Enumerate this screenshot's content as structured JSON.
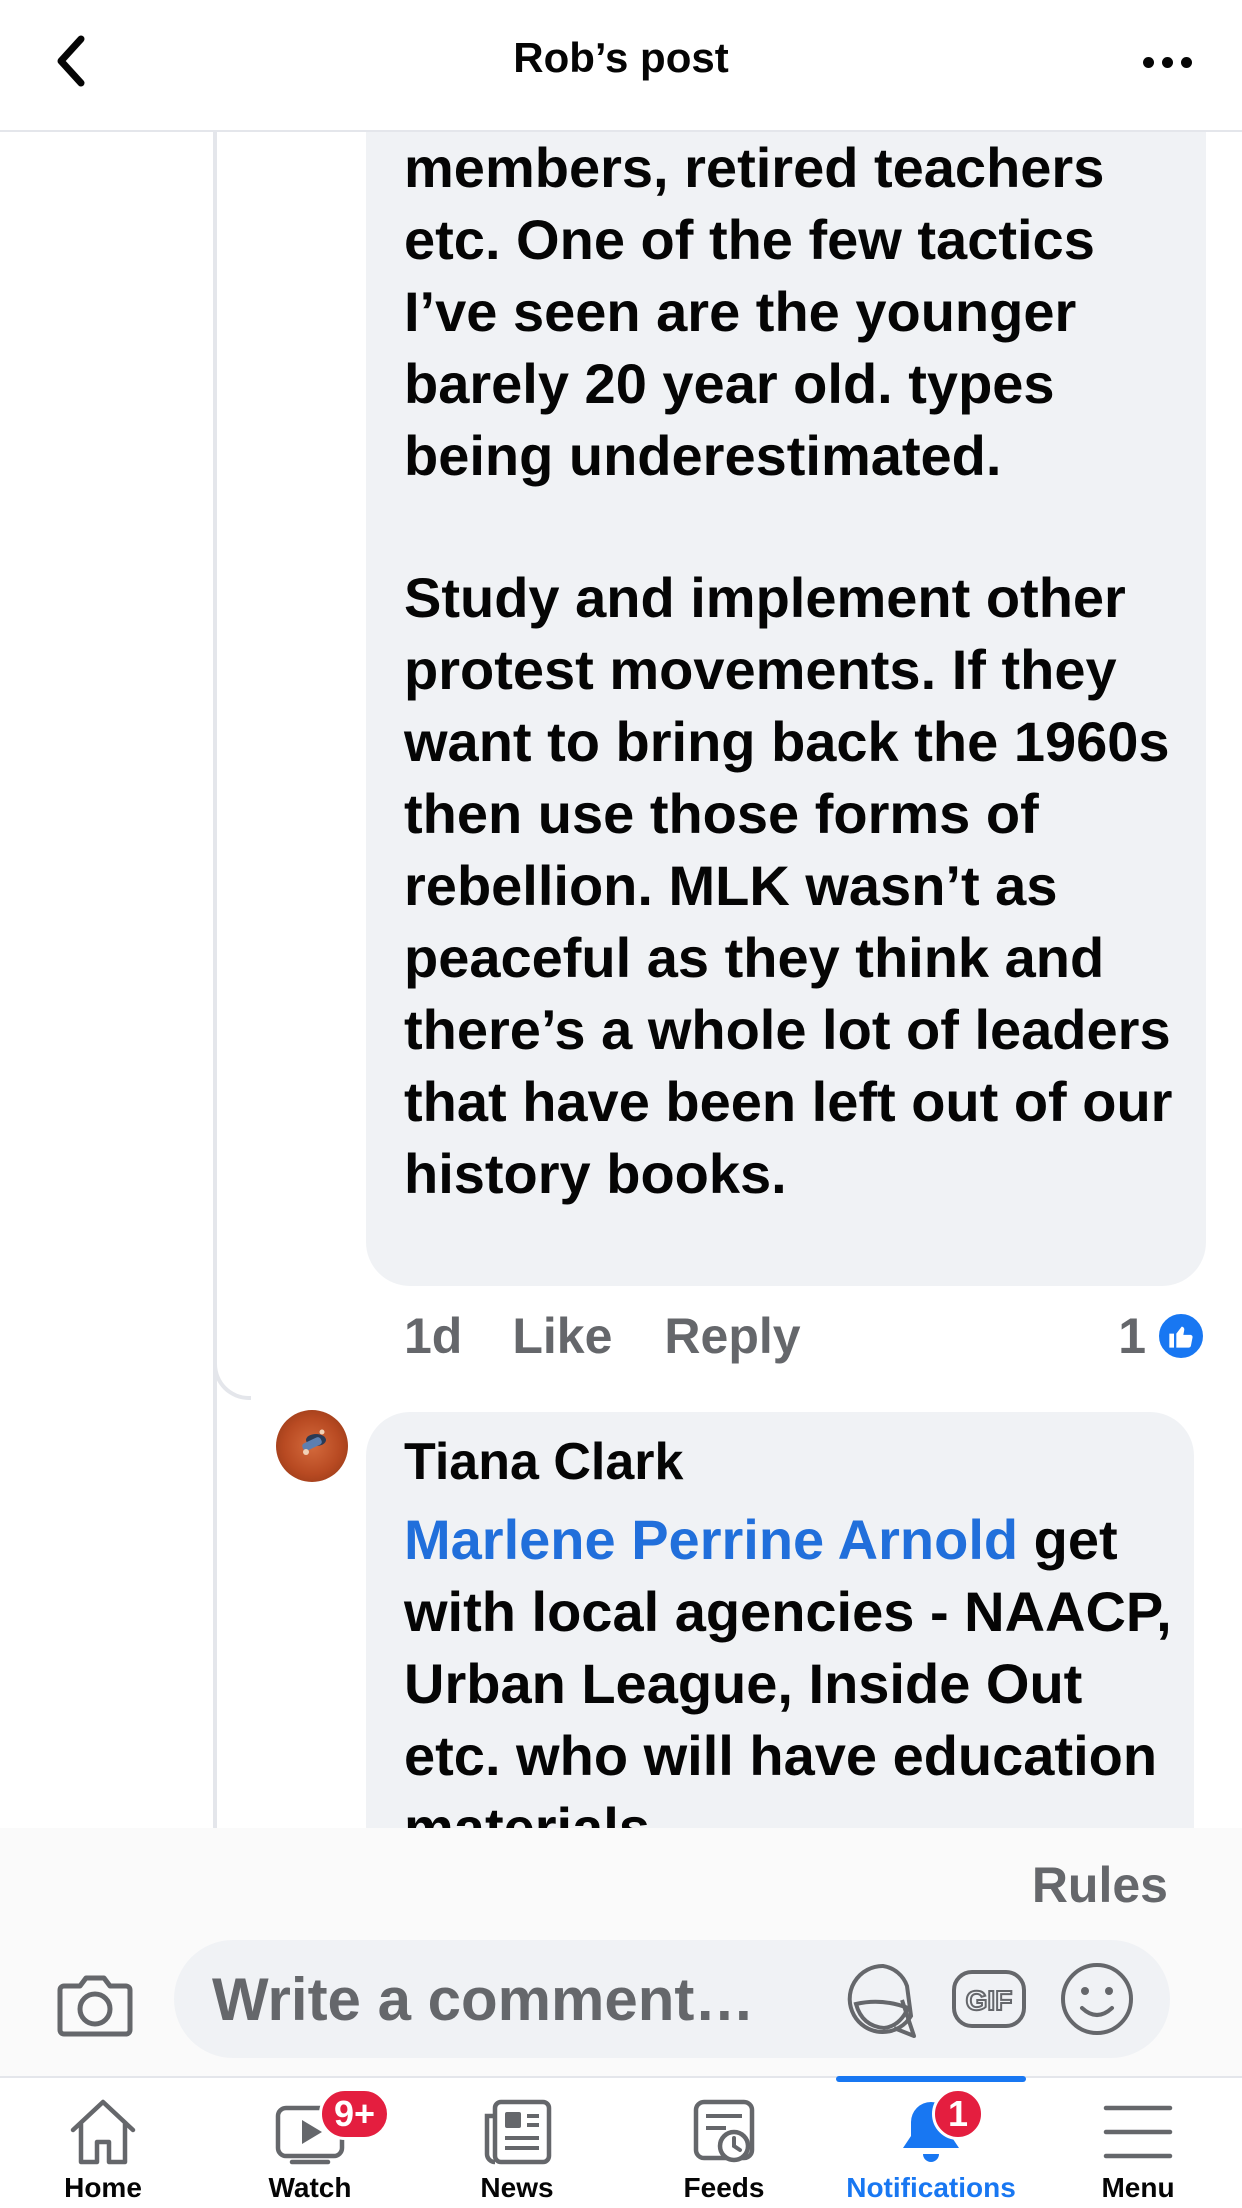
{
  "header": {
    "title": "Rob’s post"
  },
  "comments": [
    {
      "text_part1": "members, retired teachers etc. One of the few tactics I’ve seen are the younger barely 20 year old. types being underestimated.",
      "text_part2": "Study and implement other protest movements. If they want to bring back the 1960s then use those forms of rebellion. MLK wasn’t as peaceful as they think and there’s a whole lot of leaders that have been left out of our history books.",
      "time": "1d",
      "like_label": "Like",
      "reply_label": "Reply",
      "reaction_count": "1"
    },
    {
      "author": "Tiana Clark",
      "mention": "Marlene Perrine Arnold",
      "text": " get with local agencies - NAACP, Urban League, Inside Out etc. who will have education materials"
    }
  ],
  "rules_label": "Rules",
  "composer": {
    "placeholder": "Write a comment…",
    "icons": [
      "camera-icon",
      "sticker-icon",
      "gif-icon",
      "emoji-icon"
    ],
    "gif_label": "GIF"
  },
  "tabbar": {
    "tabs": [
      {
        "label": "Home",
        "icon": "home-icon"
      },
      {
        "label": "Watch",
        "icon": "watch-icon",
        "badge": "9+"
      },
      {
        "label": "News",
        "icon": "news-icon"
      },
      {
        "label": "Feeds",
        "icon": "feeds-icon"
      },
      {
        "label": "Notifications",
        "icon": "bell-icon",
        "badge": "1",
        "active": true
      },
      {
        "label": "Menu",
        "icon": "menu-icon"
      }
    ]
  },
  "colors": {
    "accent": "#1877f2",
    "mention": "#216fdb",
    "badge": "#e41e3f",
    "bubble": "#f0f2f5",
    "secondary_text": "#65676b"
  }
}
